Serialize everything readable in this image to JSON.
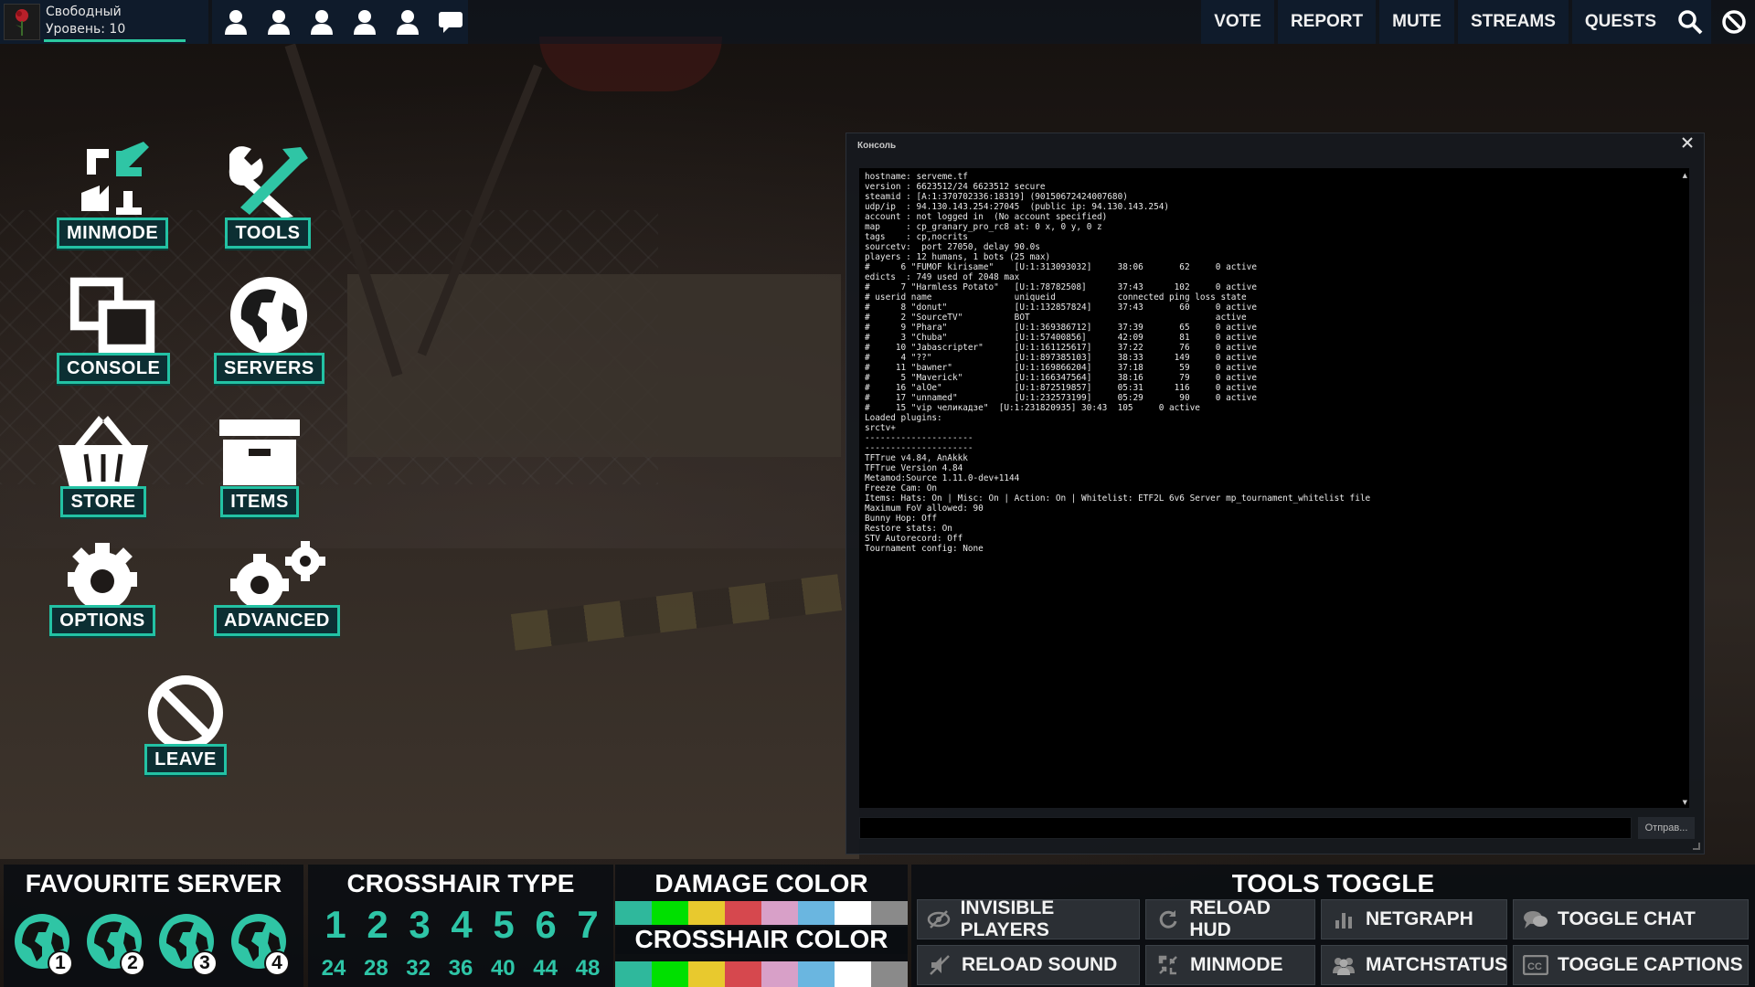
{
  "profile": {
    "status": "Свободный",
    "level": "Уровень: 10"
  },
  "party_icons": [
    "user-icon",
    "user-icon",
    "user-icon",
    "user-icon",
    "user-icon",
    "chat-icon"
  ],
  "nav": {
    "vote": "VOTE",
    "report": "REPORT",
    "mute": "MUTE",
    "streams": "STREAMS",
    "quests": "QUESTS"
  },
  "menu": {
    "minmode": "MINMODE",
    "tools": "TOOLS",
    "console": "CONSOLE",
    "servers": "SERVERS",
    "store": "STORE",
    "items": "ITEMS",
    "options": "OPTIONS",
    "advanced": "ADVANCED",
    "leave": "LEAVE"
  },
  "console": {
    "title": "Консоль",
    "submit": "Отправ...",
    "output": "hostname: serveme.tf\nversion : 6623512/24 6623512 secure\nsteamid : [A:1:370702336:18319] (90150672424007680)\nudp/ip  : 94.130.143.254:27045  (public ip: 94.130.143.254)\naccount : not logged in  (No account specified)\nmap     : cp_granary_pro_rc8 at: 0 x, 0 y, 0 z\ntags    : cp,nocrits\nsourcetv:  port 27050, delay 90.0s\nplayers : 12 humans, 1 bots (25 max)\n#      6 \"FUMOF kirisame\"    [U:1:313093032]     38:06       62     0 active\nedicts  : 749 used of 2048 max\n#      7 \"Harmless Potato\"   [U:1:78782508]      37:43      102     0 active\n# userid name                uniqueid            connected ping loss state\n#      8 \"donut\"             [U:1:132857824]     37:43       60     0 active\n#      2 \"SourceTV\"          BOT                                    active\n#      9 \"Phara\"             [U:1:369386712]     37:39       65     0 active\n#      3 \"Chuba\"             [U:1:57400856]      42:09       81     0 active\n#     10 \"Jabascripter\"      [U:1:161125617]     37:22       76     0 active\n#      4 \"??\"                [U:1:897385103]     38:33      149     0 active\n#     11 \"bawner\"            [U:1:169866204]     37:18       59     0 active\n#      5 \"Maverick\"          [U:1:166347564]     38:16       79     0 active\n#     16 \"alOe\"              [U:1:872519857]     05:31      116     0 active\n#     17 \"unnamed\"           [U:1:232573199]     05:29       90     0 active\n#     15 \"vip челикадзе\"  [U:1:231820935] 30:43  105     0 active\nLoaded plugins:\nsrctv+\n---------------------\n---------------------\nTFTrue v4.84, AnAkkk\nTFTrue Version 4.84\nMetamod:Source 1.11.0-dev+1144\nFreeze Cam: On\nItems: Hats: On | Misc: On | Action: On | Whitelist: ETF2L 6v6 Server mp_tournament_whitelist file\nMaximum FoV allowed: 90\nBunny Hop: Off\nRestore stats: On\nSTV Autorecord: Off\nTournament config: None"
  },
  "favourite_server": {
    "title": "FAVOURITE SERVER",
    "slots": [
      "1",
      "2",
      "3",
      "4"
    ]
  },
  "crosshair_type": {
    "title": "CROSSHAIR TYPE",
    "types": [
      "1",
      "2",
      "3",
      "4",
      "5",
      "6",
      "7"
    ],
    "sizes": [
      "24",
      "28",
      "32",
      "36",
      "40",
      "44",
      "48"
    ]
  },
  "damage_color": {
    "title": "DAMAGE COLOR"
  },
  "crosshair_color": {
    "title": "CROSSHAIR COLOR"
  },
  "swatch_colors": [
    "#2fb89c",
    "#00e000",
    "#e8c92e",
    "#d6484e",
    "#d8a0c8",
    "#6ab6e0",
    "#ffffff",
    "#8a8a8a"
  ],
  "tools_toggle": {
    "title": "TOOLS TOGGLE",
    "invisible_players": "INVISIBLE PLAYERS",
    "reload_hud": "RELOAD HUD",
    "netgraph": "NETGRAPH",
    "toggle_chat": "TOGGLE CHAT",
    "reload_sound": "RELOAD SOUND",
    "minmode": "MINMODE",
    "matchstatus": "MATCHSTATUS",
    "toggle_captions": "TOGGLE CAPTIONS"
  },
  "colors": {
    "accent": "#23c2a4",
    "panel": "#0f1b2b"
  }
}
